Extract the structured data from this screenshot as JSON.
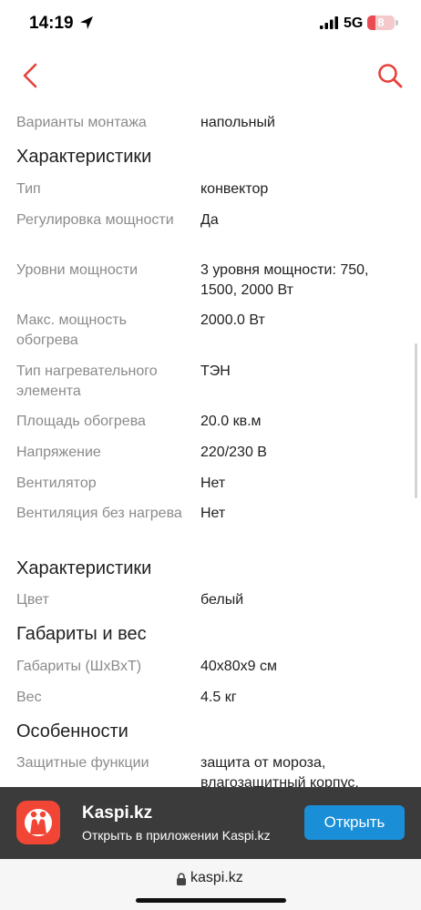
{
  "status_bar": {
    "time": "14:19",
    "network": "5G",
    "battery": "8"
  },
  "nav": {
    "back_icon": "chevron-left-icon",
    "search_icon": "search-icon"
  },
  "specs": {
    "mount_label": "Варианты монтажа",
    "mount_value": "напольный",
    "section_1": "Характеристики",
    "rows_1": [
      {
        "label": "Тип",
        "value": "конвектор"
      },
      {
        "label": "Регулировка мощности",
        "value": "Да"
      },
      {
        "label": "Уровни мощности",
        "value": "3 уровня мощности: 750, 1500, 2000 Вт"
      },
      {
        "label": "Макс. мощность обогрева",
        "value": "2000.0 Вт"
      },
      {
        "label": "Тип нагревательного элемента",
        "value": "ТЭН"
      },
      {
        "label": "Площадь обогрева",
        "value": "20.0 кв.м"
      },
      {
        "label": "Напряжение",
        "value": "220/230 В"
      },
      {
        "label": "Вентилятор",
        "value": "Нет"
      },
      {
        "label": "Вентиляция без нагрева",
        "value": "Нет"
      }
    ],
    "section_2": "Характеристики",
    "rows_2": [
      {
        "label": "Цвет",
        "value": "белый"
      }
    ],
    "section_3": "Габариты и вес",
    "rows_3": [
      {
        "label": "Габариты (ШхВхТ)",
        "value": "40х80х9 см"
      },
      {
        "label": "Вес",
        "value": "4.5 кг"
      }
    ],
    "section_4": "Особенности",
    "rows_4": [
      {
        "label": "Защитные функции",
        "value": "защита от мороза, влагозащитный корпус,"
      }
    ]
  },
  "banner": {
    "title": "Kaspi.kz",
    "subtitle": "Открыть в приложении Kaspi.kz",
    "open_label": "Открыть",
    "logo_icon": "kaspi-logo-icon"
  },
  "address_bar": {
    "domain": "kaspi.kz",
    "lock_icon": "lock-icon"
  },
  "colors": {
    "accent": "#e8403a",
    "banner_bg": "#3b3b3b",
    "button_blue": "#1a8fd8",
    "label_gray": "#8b8b8b"
  }
}
